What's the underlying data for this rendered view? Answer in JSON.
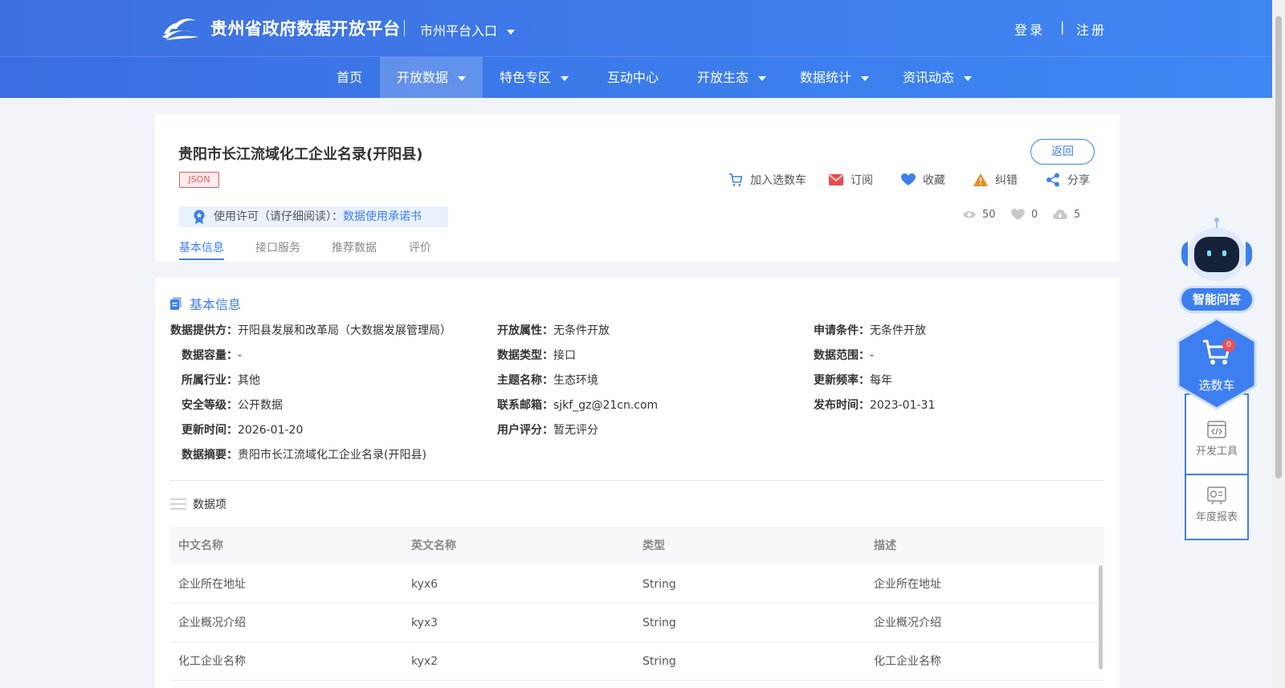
{
  "header": {
    "site_title": "贵州省政府数据开放平台",
    "city_entry": "市州平台入口",
    "login": "登录",
    "separator": "|",
    "register": "注册"
  },
  "nav": {
    "items": [
      {
        "label": "首页",
        "has_dropdown": false
      },
      {
        "label": "开放数据",
        "has_dropdown": true,
        "active": true
      },
      {
        "label": "特色专区",
        "has_dropdown": true
      },
      {
        "label": "互动中心",
        "has_dropdown": false
      },
      {
        "label": "开放生态",
        "has_dropdown": true
      },
      {
        "label": "数据统计",
        "has_dropdown": true
      },
      {
        "label": "资讯动态",
        "has_dropdown": true
      }
    ]
  },
  "dataset": {
    "title": "贵阳市长江流域化工企业名录(开阳县)",
    "format_tag": "JSON",
    "back_label": "返回",
    "actions": {
      "cart": "加入选数车",
      "subscribe": "订阅",
      "favorite": "收藏",
      "report": "纠错",
      "share": "分享"
    },
    "license": {
      "label": "使用许可（请仔细阅读）：",
      "link": "数据使用承诺书"
    },
    "stats": {
      "views": "50",
      "likes": "0",
      "downloads": "5"
    },
    "tabs": [
      "基本信息",
      "接口服务",
      "推荐数据",
      "评价"
    ]
  },
  "basic_info": {
    "section_title": "基本信息",
    "fields": {
      "provider": {
        "label": "数据提供方：",
        "value": "开阳县发展和改革局（大数据发展管理局）"
      },
      "open_attr": {
        "label": "开放属性：",
        "value": "无条件开放"
      },
      "apply_cond": {
        "label": "申请条件：",
        "value": "无条件开放"
      },
      "capacity": {
        "label": "数据容量：",
        "value": "-"
      },
      "data_type": {
        "label": "数据类型：",
        "value": "接口"
      },
      "data_scope": {
        "label": "数据范围：",
        "value": "-"
      },
      "industry": {
        "label": "所属行业：",
        "value": "其他"
      },
      "theme": {
        "label": "主题名称：",
        "value": "生态环境"
      },
      "frequency": {
        "label": "更新频率：",
        "value": "每年"
      },
      "security": {
        "label": "安全等级：",
        "value": "公开数据"
      },
      "email": {
        "label": "联系邮箱：",
        "value": "sjkf_gz@21cn.com"
      },
      "publish": {
        "label": "发布时间：",
        "value": "2023-01-31"
      },
      "updated": {
        "label": "更新时间：",
        "value": "2026-01-20"
      },
      "rating": {
        "label": "用户评分：",
        "value": "暂无评分"
      },
      "summary": {
        "label": "数据摘要：",
        "value": "贵阳市长江流域化工企业名录(开阳县)"
      }
    }
  },
  "data_items": {
    "title": "数据项",
    "columns": [
      "中文名称",
      "英文名称",
      "类型",
      "描述"
    ],
    "rows": [
      [
        "企业所在地址",
        "kyx6",
        "String",
        "企业所在地址"
      ],
      [
        "企业概况介绍",
        "kyx3",
        "String",
        "企业概况介绍"
      ],
      [
        "化工企业名称",
        "kyx2",
        "String",
        "化工企业名称"
      ]
    ]
  },
  "sidebar": {
    "ai_label": "智能问答",
    "cart_label": "选数车",
    "cart_count": "0",
    "dev_tools": "开发工具",
    "annual_report": "年度报表"
  }
}
